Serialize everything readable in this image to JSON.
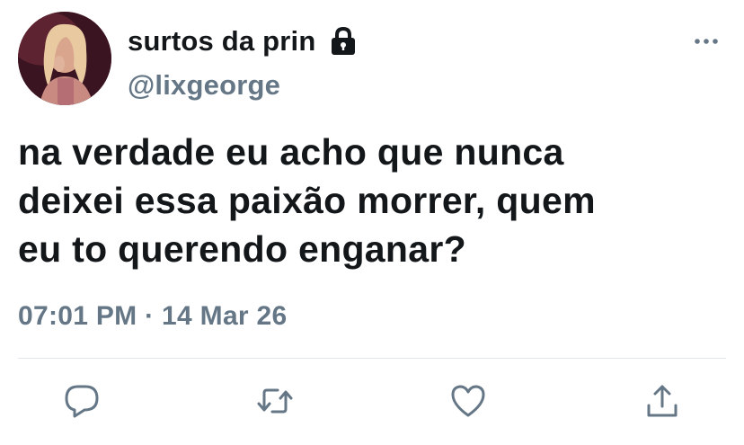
{
  "user": {
    "display_name": "surtos da prin",
    "handle": "@lixgeorge",
    "protected_icon": "lock-icon",
    "avatar_icon": "avatar"
  },
  "tweet": {
    "text_lines": [
      "na verdade eu acho que nunca",
      "deixei essa paixão morrer, quem",
      "eu to querendo enganar?"
    ],
    "time": "07:01 PM",
    "separator": "·",
    "date": "14 Mar 26"
  },
  "menu": {
    "icon": "more-icon"
  },
  "actions": [
    {
      "icon": "reply-icon"
    },
    {
      "icon": "retweet-icon"
    },
    {
      "icon": "like-icon"
    },
    {
      "icon": "share-icon"
    }
  ],
  "colors": {
    "primary_text": "#14171a",
    "secondary_text": "#657786",
    "divider": "#e1e8ed",
    "icon": "#657786"
  }
}
